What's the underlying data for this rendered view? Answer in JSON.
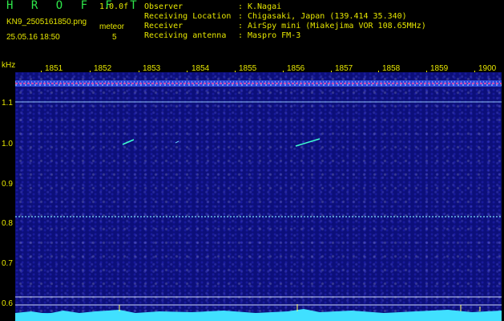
{
  "header": {
    "logo": "H R O F F T",
    "version": "1.0.0f",
    "filename": "KN9_2505161850.png",
    "meteor_label": "meteor",
    "datetime": "25.05.16  18:50",
    "meteor_count": "5"
  },
  "info": [
    {
      "key": "Observer",
      "value": "K.Nagai"
    },
    {
      "key": "Receiving Location",
      "value": "Chigasaki, Japan (139.414 35.340)"
    },
    {
      "key": "Receiver",
      "value": "AirSpy mini (Miakejima VOR 108.65MHz)"
    },
    {
      "key": "Receiving antenna",
      "value": "Maspro FM-3"
    }
  ],
  "colon": ":",
  "axis": {
    "ylabel": "kHz",
    "y_ticks": [
      "1.1",
      "1.0",
      "0.9",
      "0.8",
      "0.7",
      "0.6"
    ],
    "x_ticks": [
      "1851",
      "1852",
      "1853",
      "1854",
      "1855",
      "1856",
      "1857",
      "1858",
      "1859",
      "1900"
    ]
  }
}
